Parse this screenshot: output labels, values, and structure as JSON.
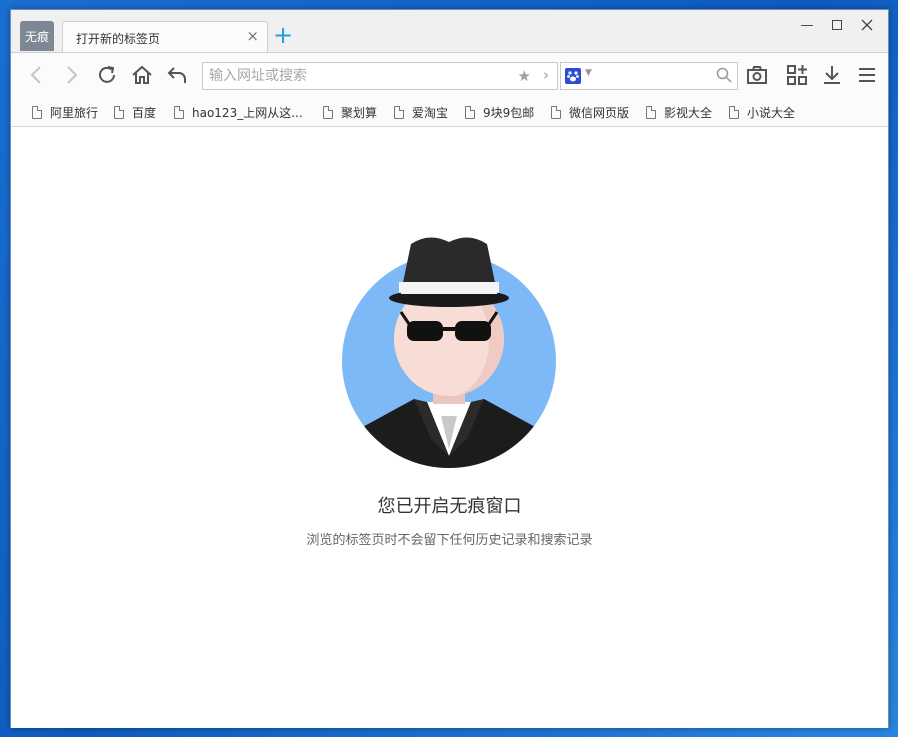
{
  "window": {
    "incognito_badge": "无痕",
    "tab_title": "打开新的标签页",
    "tab_close": "×",
    "new_tab": "+",
    "min_symbol": "—"
  },
  "toolbar": {
    "address_placeholder": "输入网址或搜索",
    "search_placeholder": ""
  },
  "icons": {
    "back": "chevron-left-icon",
    "forward": "chevron-right-icon",
    "reload": "reload-icon",
    "home": "home-icon",
    "undo": "undo-icon",
    "star": "star-icon",
    "screenshot": "camera-icon",
    "apps": "apps-icon",
    "download": "download-icon",
    "menu": "menu-icon"
  },
  "bookmarks": [
    {
      "label": "阿里旅行"
    },
    {
      "label": "百度"
    },
    {
      "label": "hao123_上网从这..."
    },
    {
      "label": "聚划算"
    },
    {
      "label": "爱淘宝"
    },
    {
      "label": "9块9包邮"
    },
    {
      "label": "微信网页版"
    },
    {
      "label": "影视大全"
    },
    {
      "label": "小说大全"
    }
  ],
  "content": {
    "headline": "您已开启无痕窗口",
    "subline": "浏览的标签页时不会留下任何历史记录和搜索记录"
  },
  "colors": {
    "accent": "#1e9fe0",
    "avatar_bg": "#7eb9f7",
    "badge_bg": "#7d8894"
  }
}
